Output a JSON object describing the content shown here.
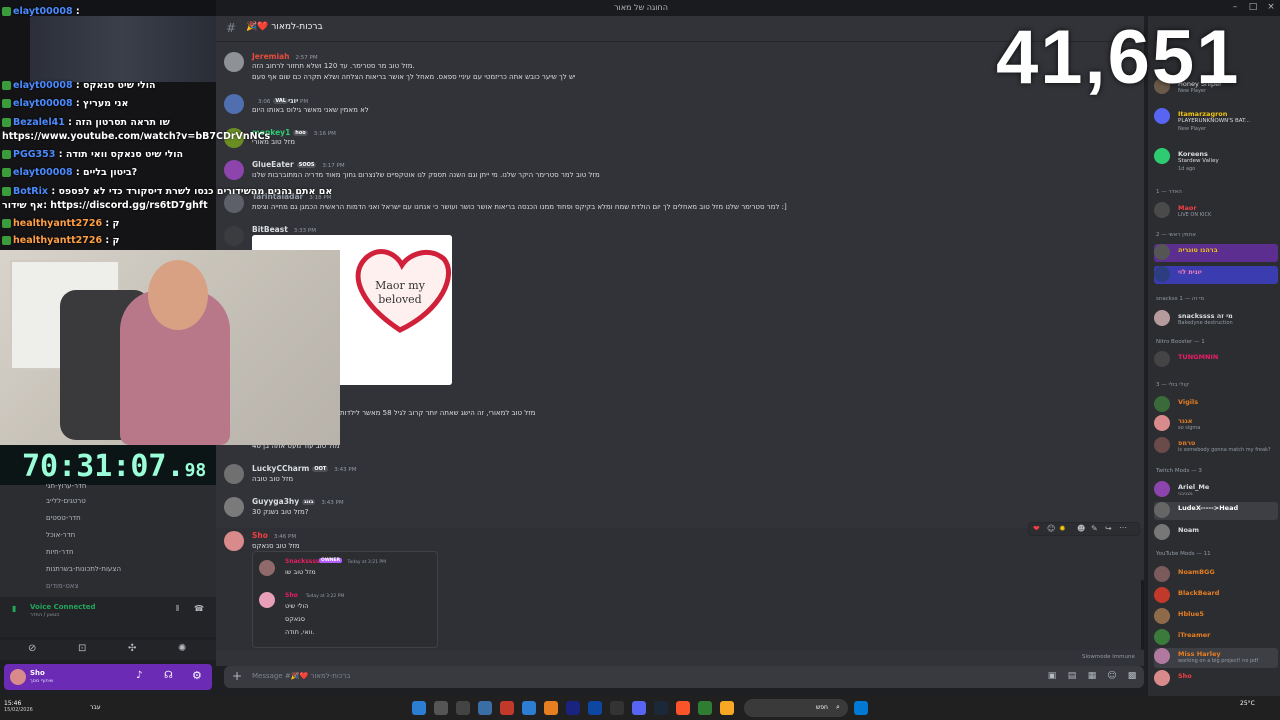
{
  "window": {
    "title": "החוגה של מאור"
  },
  "channel": {
    "name": "🎉❤️ ברכות-למאור"
  },
  "viewer_count": "41,651",
  "stream_timer": {
    "main": "70:31:07.",
    "frac": "98"
  },
  "messages": [
    {
      "author": "Jeremiah",
      "time": "2:57 PM",
      "color": "#e74c3c",
      "text_1": "מזל טוב מר סטרימר. עד 120 ושלא תחזור לרחוב הזה.",
      "text_2": "יש לך שיער כובש אתה כריזמטי עם עיניי ספאס. מאחל לך אושר בריאות הצלחה ושלא תקרה כם שום אף פעם"
    },
    {
      "author": "יוגי",
      "time": "3:06 PM",
      "color": "#dbdee1",
      "tag": "VAL",
      "text_1": "לא מאמין שאני מאשר גילוס באותו היום"
    },
    {
      "author": "monkey1",
      "time": "3:16 PM",
      "color": "#2ecc71",
      "tag": "hoo",
      "text_1": "מזל טוב מאורי"
    },
    {
      "author": "GlueEater",
      "time": "3:17 PM",
      "color": "#dbdee1",
      "tag": "SOOS",
      "text_1": "מזל טוב למר סטרימר היקר שלנו. מי ייתן וגם השנה תספק לנו אוטקפיים שלנצרום גחוך מאוד מדריה המתוברבות שלנו"
    },
    {
      "author": "Tarintaladar",
      "time": "3:18 PM",
      "color": "#dbdee1",
      "text_1": "למר סטרימר שלנו מזל טוב מאחלים לך יום הולדת שמח ומלא בקיקס ופחוד ממנו הכנסה בריאות אושר כושר ועושר כי אנחנו עם ישראל ואני הדמות הראשית הכמגן גם מחייה וציפת :]"
    },
    {
      "author": "BitBeast",
      "time": "3:33 PM",
      "color": "#dbdee1"
    },
    {
      "text_1": "מזל טוב למאורי, זה הישג שאתה יותר קרוב לגיל 58 מאשר לילדות"
    },
    {
      "text_1": "מזל טוב עוד מעט אתה בן 40"
    },
    {
      "author": "LuckyCCharm",
      "time": "3:43 PM",
      "color": "#dbdee1",
      "tag": "OOT",
      "text_1": "מזל טוב טובה"
    },
    {
      "author": "Guyyga3hy",
      "time": "3:43 PM",
      "color": "#dbdee1",
      "tag": "בונג",
      "text_1": "מזל טוב נשנק 30?"
    },
    {
      "author": "Sho",
      "time": "3:46 PM",
      "color": "#f23f43",
      "text_1": "מזל טוב סנאקס"
    }
  ],
  "image_text": {
    "line1": "Maor my",
    "line2": "beloved"
  },
  "quote": {
    "author1": "Snackssss",
    "badge1": "OWNER",
    "time1": "Today at 3:21 PM",
    "text1": "מזל טוב שו",
    "author2": "Sho",
    "time2": "Today at 3:22 PM",
    "text2a": "הולי שיט",
    "text2b": "סנאקס",
    "text2c": "וואי, תודה."
  },
  "composer": {
    "placeholder": "Message #🎉❤️ ברכות-למאור",
    "slowmode": "Slowmode immune"
  },
  "members": {
    "now_playing": [
      {
        "name": "Honey Sniper",
        "sub": "Brokeville",
        "sub2": "New Player"
      },
      {
        "name": "Itamarzagron",
        "sub": "PLAYERUNKNOWN'S BAT...",
        "sub2": "New Player"
      },
      {
        "name": "Koreens",
        "sub": "Stardew Valley",
        "sub2": "1d ago"
      }
    ],
    "cat_1": "האדר — 1",
    "m1": {
      "name": "Maor",
      "sub": "LIVE ON KICK",
      "color": "#f23f43"
    },
    "cat_2": "אחמין ראשי — 2",
    "m2": {
      "name": "ברהנו טונריה",
      "color": "#f1c40f",
      "tag": "wow"
    },
    "m3": {
      "name": "יונית לוי",
      "color": "#e91e63",
      "tag": "SOOS"
    },
    "cat_3": "snackss מי זה — 1",
    "m4": {
      "name": "snackssss מי זה",
      "sub": "Bakedyne destruction",
      "color": "#dbdee1",
      "tag": "APP"
    },
    "cat_4": "Nitro Booster — 1",
    "m5": {
      "name": "TUNGMNIN",
      "color": "#e91e63",
      "tag": "TBOI"
    },
    "cat_5": "קולי בולי — 3",
    "m6": {
      "name": "Vigils",
      "color": "#e67e22"
    },
    "m7": {
      "name": "אגגר",
      "sub": "so sigma",
      "color": "#e67e22"
    },
    "m8": {
      "name": "טרמפ",
      "sub": "is somebody gonna match my freak?",
      "color": "#e67e22"
    },
    "cat_6": "Twitch Mods — 3",
    "m9": {
      "name": "Ariel_Me",
      "sub": "מגניבני",
      "color": "#dbdee1"
    },
    "m10": {
      "name": "LudeX----->Head",
      "color": "#ffffff"
    },
    "m11": {
      "name": "Noam",
      "color": "#dbdee1",
      "tag": "TKN"
    },
    "cat_7": "YouTube Mods — 11",
    "m12": {
      "name": "NoamBGG",
      "color": "#e67e22"
    },
    "m13": {
      "name": "BlackBeard",
      "color": "#e67e22"
    },
    "m14": {
      "name": "Hblue5",
      "color": "#e67e22",
      "tag": "GYM"
    },
    "m15": {
      "name": "iTreamer",
      "color": "#e67e22"
    },
    "m16": {
      "name": "Miss Harley",
      "sub": "working on a big project! no pdf",
      "color": "#e67e22",
      "tag": "YAOI"
    },
    "m17": {
      "name": "Sho",
      "color": "#f23f43"
    }
  },
  "chat_overlay": [
    {
      "who": "elayt00008",
      "text": ":"
    },
    {
      "who": "elayt00008",
      "text": ": הולי שיט סנאקס"
    },
    {
      "who": "elayt00008",
      "text": ": אני מעריץ"
    },
    {
      "who": "Bezalel41",
      "text": ": שו תראה תסרטון הזה https://www.youtube.com/watch?v=bB7CDrVnNCs"
    },
    {
      "who": "PGG353",
      "text": ": הולי שיט סנאקס וואי תודה"
    },
    {
      "who": "elayt00008",
      "text": ": ביטון בליים?"
    },
    {
      "who": "BotRix",
      "text": ": אם אתם נהנים מהשידורים כנסו לשרת דיסקורד כדי לא לפספס אף שידור: https://discord.gg/rs6tD7ghft"
    },
    {
      "who": "healthyantt2726",
      "text": ": ק"
    },
    {
      "who": "healthyantt2726",
      "text": ": ק"
    }
  ],
  "channels": [
    "חדר-ערוץ-חגי",
    "טרטגים-ללייב",
    "חדר-טסטים",
    "חדר-אוכל",
    "חדר-חיות",
    "הצעות-לתכונות-בשרתנות",
    "צאט-מודים"
  ],
  "voice": {
    "status": "Voice Connected",
    "sub": "הטאון / החדר"
  },
  "user": {
    "name": "Sho",
    "status": "שיתוף מסך"
  },
  "taskbar": {
    "time": "15:46",
    "date": "15/02/2026",
    "search": "חפש",
    "weather": "25°C",
    "lang": "עבר"
  }
}
